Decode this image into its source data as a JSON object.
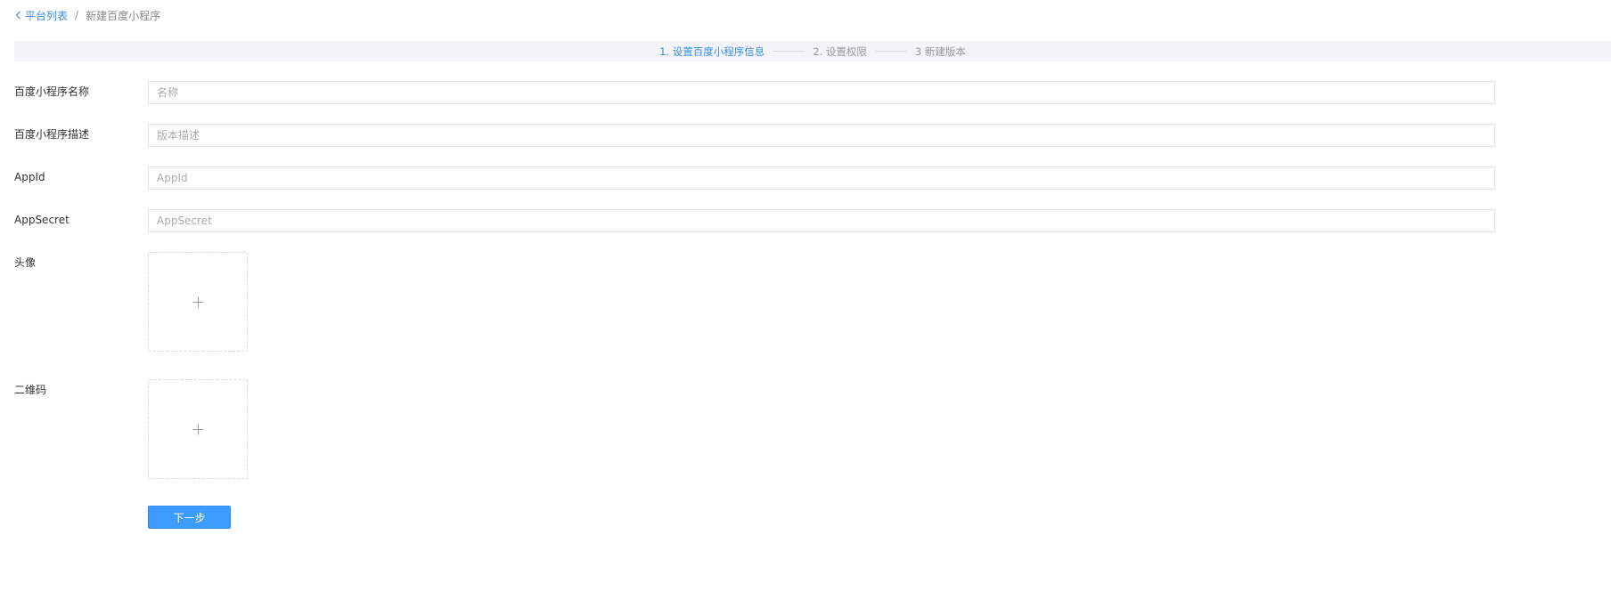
{
  "breadcrumb": {
    "back_label": "平台列表",
    "separator": "/",
    "current": "新建百度小程序"
  },
  "steps": [
    {
      "label": "1. 设置百度小程序信息",
      "state": "active"
    },
    {
      "label": "2. 设置权限",
      "state": "inactive"
    },
    {
      "label": "3 新建版本",
      "state": "inactive"
    }
  ],
  "form": {
    "name": {
      "label": "百度小程序名称",
      "placeholder": "名称",
      "value": ""
    },
    "description": {
      "label": "百度小程序描述",
      "placeholder": "版本描述",
      "value": ""
    },
    "appid": {
      "label": "AppId",
      "placeholder": "AppId",
      "value": ""
    },
    "appsecret": {
      "label": "AppSecret",
      "placeholder": "AppSecret",
      "value": ""
    },
    "avatar": {
      "label": "头像"
    },
    "qrcode": {
      "label": "二维码"
    }
  },
  "actions": {
    "next_label": "下一步"
  },
  "colors": {
    "accent": "#3a8ee6",
    "primary_button": "#3c9cfd",
    "steps_background": "#f4f5f8"
  },
  "icons": {
    "back": "chevron-left-icon",
    "upload": "plus-icon"
  }
}
